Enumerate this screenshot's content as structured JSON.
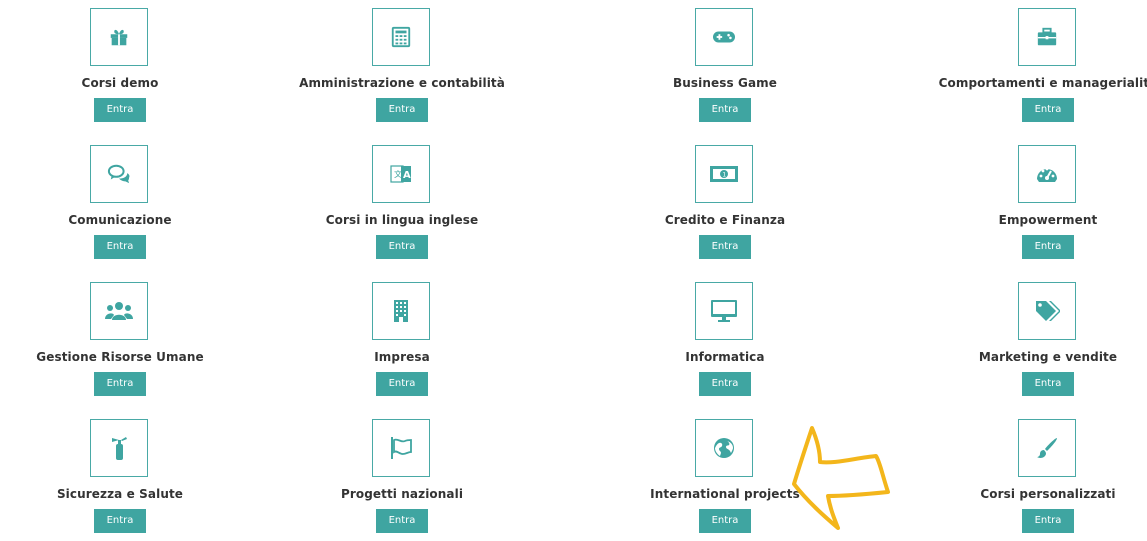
{
  "button_label": "Entra",
  "colors": {
    "accent": "#3fa5a1",
    "border": "#49a9a6",
    "text": "#333333",
    "annotation": "#f3b61b"
  },
  "courses": [
    {
      "title": "Corsi demo",
      "icon": "gift-icon"
    },
    {
      "title": "Amministrazione e contabilità",
      "icon": "calculator-icon"
    },
    {
      "title": "Business Game",
      "icon": "gamepad-icon"
    },
    {
      "title": "Comportamenti e managerialità",
      "icon": "briefcase-icon"
    },
    {
      "title": "Comunicazione",
      "icon": "chat-bubbles-icon"
    },
    {
      "title": "Corsi in lingua inglese",
      "icon": "language-icon"
    },
    {
      "title": "Credito e Finanza",
      "icon": "banknote-icon"
    },
    {
      "title": "Empowerment",
      "icon": "dashboard-icon"
    },
    {
      "title": "Gestione Risorse Umane",
      "icon": "users-icon"
    },
    {
      "title": "Impresa",
      "icon": "building-icon"
    },
    {
      "title": "Informatica",
      "icon": "monitor-icon"
    },
    {
      "title": "Marketing e vendite",
      "icon": "tags-icon"
    },
    {
      "title": "Sicurezza e Salute",
      "icon": "fire-extinguisher-icon"
    },
    {
      "title": "Progetti nazionali",
      "icon": "flag-icon"
    },
    {
      "title": "International projects",
      "icon": "globe-icon"
    },
    {
      "title": "Corsi personalizzati",
      "icon": "paintbrush-icon"
    }
  ],
  "annotation": {
    "icon": "arrow-left-icon"
  }
}
